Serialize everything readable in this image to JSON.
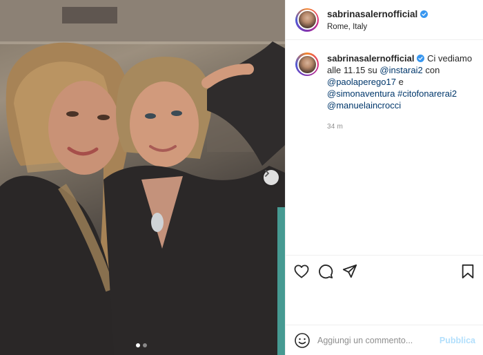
{
  "post": {
    "username": "sabrinasalernofficial",
    "location": "Rome, Italy",
    "caption": {
      "username": "sabrinasalernofficial",
      "text_1": "Ci vediamo alle 11.15 su",
      "mention_1": "@instarai2",
      "text_2": "con",
      "mention_2": "@paolaperego17",
      "text_3": "e",
      "mention_3": "@simonaventura",
      "hashtag_1": "#citofonarerai2",
      "mention_4": "@manuelaincrocci"
    },
    "time": "34 m",
    "carousel": {
      "count": 2,
      "active": 1
    }
  },
  "comment": {
    "placeholder": "Aggiungi un commento...",
    "publish_label": "Pubblica"
  },
  "icons": {
    "verified": "verified-badge-icon",
    "like": "heart-icon",
    "comment": "comment-bubble-icon",
    "share": "paper-plane-icon",
    "save": "bookmark-icon",
    "emoji": "smiley-icon",
    "next": "chevron-right-icon"
  },
  "colors": {
    "verified": "#3897f0",
    "link": "#00376b",
    "publish_disabled": "#b2dffc"
  }
}
